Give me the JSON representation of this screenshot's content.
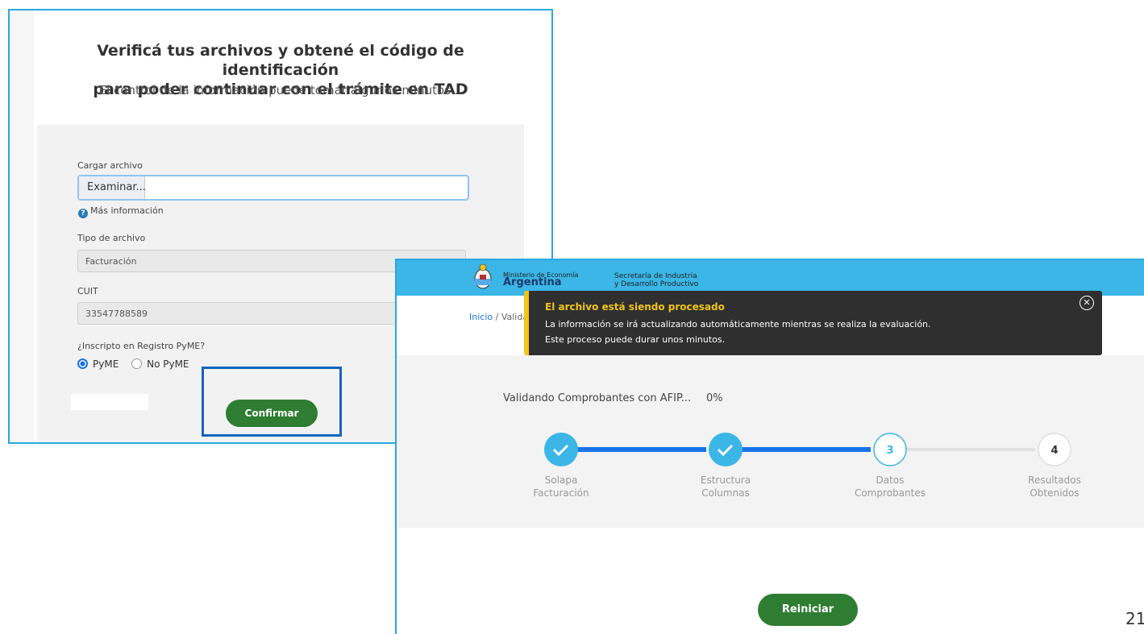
{
  "left": {
    "title_line1": "Verificá tus archivos y obtené el código de identificación",
    "title_line2": "para poder continuar con el trámite en TAD",
    "subtitle": "El control de la información puede tomar algunos minutos...",
    "file_label": "Cargar archivo",
    "browse_label": "Examinar...",
    "more_info": "Más información",
    "type_label": "Tipo de archivo",
    "type_value": "Facturación",
    "cuit_label": "CUIT",
    "cuit_value": "33547788589",
    "pyme_question": "¿Inscripto en Registro PyME?",
    "radio_pyme": "PyME",
    "radio_no_pyme": "No PyME",
    "radio_selected": "PyME",
    "confirm_label": "Confirmar"
  },
  "right": {
    "ministry_line1": "Ministerio de Economía",
    "ministry_line2": "Argentina",
    "secretaria_line1": "Secretaría de Industria",
    "secretaria_line2": "y Desarrollo Productivo",
    "breadcrumb_link": "Inicio",
    "breadcrumb_rest": "Valida",
    "progress_label": "Validando Comprobantes con AFIP...",
    "progress_percent": "0%",
    "steps": [
      {
        "label1": "Solapa",
        "label2": "Facturación",
        "state": "done"
      },
      {
        "label1": "Estructura",
        "label2": "Columnas",
        "state": "done"
      },
      {
        "label1": "Datos",
        "label2": "Comprobantes",
        "state": "current",
        "num": "3"
      },
      {
        "label1": "Resultados",
        "label2": "Obtenidos",
        "state": "pending",
        "num": "4"
      }
    ],
    "reiniciar_label": "Reiniciar"
  },
  "toast": {
    "title": "El archivo está siendo procesado",
    "line1": "La información se irá actualizando automáticamente mientras se realiza la evaluación.",
    "line2": "Este proceso puede durar unos minutos.",
    "close_icon": "close-circle-icon"
  },
  "page_number": "21",
  "colors": {
    "accent_blue": "#1a73e8",
    "header_blue": "#3bb6e6",
    "button_green": "#2e7d32",
    "toast_yellow": "#f0c419",
    "step_done": "#3bb6e6"
  }
}
